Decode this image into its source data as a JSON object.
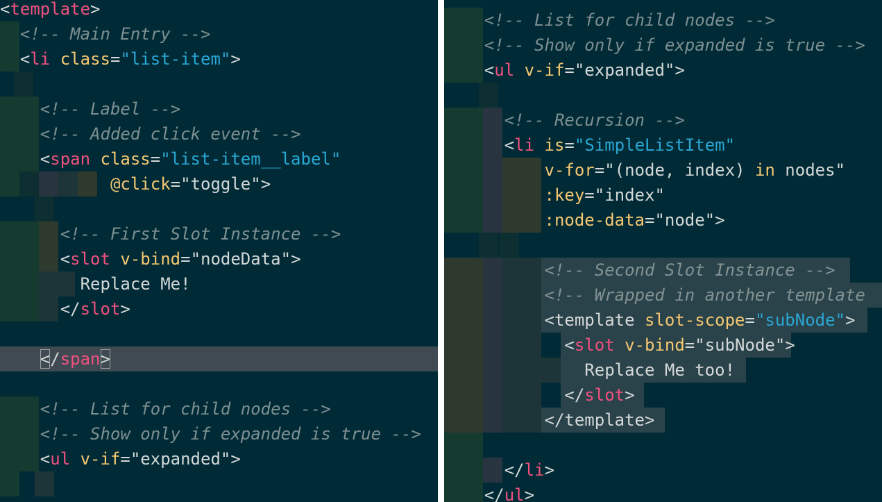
{
  "left_pane": {
    "lines": [
      [
        {
          "t": "<",
          "c": "c-punct"
        },
        {
          "t": "template",
          "c": "c-tag"
        },
        {
          "t": ">",
          "c": "c-punct"
        }
      ],
      [
        {
          "t": "  <!-- Main Entry -->",
          "c": "c-comment"
        }
      ],
      [
        {
          "t": "  <",
          "c": "c-punct"
        },
        {
          "t": "li",
          "c": "c-tag"
        },
        {
          "t": " class",
          "c": "c-attr"
        },
        {
          "t": "=",
          "c": "c-eq"
        },
        {
          "t": "\"list-item\"",
          "c": "c-str"
        },
        {
          "t": ">",
          "c": "c-punct"
        }
      ],
      [],
      [
        {
          "t": "    <!-- Label -->",
          "c": "c-comment"
        }
      ],
      [
        {
          "t": "    <!-- Added click event -->",
          "c": "c-comment"
        }
      ],
      [
        {
          "t": "    <",
          "c": "c-punct"
        },
        {
          "t": "span",
          "c": "c-tag"
        },
        {
          "t": " class",
          "c": "c-attr"
        },
        {
          "t": "=",
          "c": "c-eq"
        },
        {
          "t": "\"list-item__label\"",
          "c": "c-str"
        }
      ],
      [
        {
          "t": "           @click",
          "c": "c-attr"
        },
        {
          "t": "=",
          "c": "c-eq"
        },
        {
          "t": "\"toggle\"",
          "c": "c-text"
        },
        {
          "t": ">",
          "c": "c-punct"
        }
      ],
      [],
      [
        {
          "t": "      <!-- First Slot Instance -->",
          "c": "c-comment"
        }
      ],
      [
        {
          "t": "      <",
          "c": "c-punct"
        },
        {
          "t": "slot",
          "c": "c-tag"
        },
        {
          "t": " v-bind",
          "c": "c-attr"
        },
        {
          "t": "=",
          "c": "c-eq"
        },
        {
          "t": "\"nodeData\"",
          "c": "c-text"
        },
        {
          "t": ">",
          "c": "c-punct"
        }
      ],
      [
        {
          "t": "        Replace Me!",
          "c": "c-text"
        }
      ],
      [
        {
          "t": "      </",
          "c": "c-punct"
        },
        {
          "t": "slot",
          "c": "c-tag"
        },
        {
          "t": ">",
          "c": "c-punct"
        }
      ],
      [],
      [
        {
          "t": "    </",
          "c": "c-punct"
        },
        {
          "t": "span",
          "c": "c-tag"
        },
        {
          "t": ">",
          "c": "c-punct"
        }
      ],
      [],
      [
        {
          "t": "    <!-- List for child nodes -->",
          "c": "c-comment"
        }
      ],
      [
        {
          "t": "    <!-- Show only if expanded is true -->",
          "c": "c-comment"
        }
      ],
      [
        {
          "t": "    <",
          "c": "c-punct"
        },
        {
          "t": "ul",
          "c": "c-tag"
        },
        {
          "t": " v-if",
          "c": "c-attr"
        },
        {
          "t": "=",
          "c": "c-eq"
        },
        {
          "t": "\"expanded\"",
          "c": "c-text"
        },
        {
          "t": ">",
          "c": "c-punct"
        }
      ],
      []
    ]
  },
  "right_pane": {
    "lines": [
      [
        {
          "t": "    <!-- List for child nodes -->",
          "c": "c-comment"
        }
      ],
      [
        {
          "t": "    <!-- Show only if expanded is true -->",
          "c": "c-comment"
        }
      ],
      [
        {
          "t": "    <",
          "c": "c-punct"
        },
        {
          "t": "ul",
          "c": "c-tag"
        },
        {
          "t": " v-if",
          "c": "c-attr"
        },
        {
          "t": "=",
          "c": "c-eq"
        },
        {
          "t": "\"expanded\"",
          "c": "c-text"
        },
        {
          "t": ">",
          "c": "c-punct"
        }
      ],
      [],
      [
        {
          "t": "      <!-- Recursion -->",
          "c": "c-comment"
        }
      ],
      [
        {
          "t": "      <",
          "c": "c-punct"
        },
        {
          "t": "li",
          "c": "c-tag"
        },
        {
          "t": " is",
          "c": "c-attr"
        },
        {
          "t": "=",
          "c": "c-eq"
        },
        {
          "t": "\"SimpleListItem\"",
          "c": "c-str"
        }
      ],
      [
        {
          "t": "          v-for",
          "c": "c-attr"
        },
        {
          "t": "=",
          "c": "c-eq"
        },
        {
          "t": "\"(node, index) ",
          "c": "c-text"
        },
        {
          "t": "in",
          "c": "c-attr"
        },
        {
          "t": " nodes\"",
          "c": "c-text"
        }
      ],
      [
        {
          "t": "          :key",
          "c": "c-attr"
        },
        {
          "t": "=",
          "c": "c-eq"
        },
        {
          "t": "\"index\"",
          "c": "c-text"
        }
      ],
      [
        {
          "t": "          :node-data",
          "c": "c-attr"
        },
        {
          "t": "=",
          "c": "c-eq"
        },
        {
          "t": "\"node\"",
          "c": "c-text"
        },
        {
          "t": ">",
          "c": "c-punct"
        }
      ],
      [],
      [
        {
          "t": "          <!-- Second Slot Instance -->",
          "c": "c-comment"
        }
      ],
      [
        {
          "t": "          <!-- Wrapped in another template",
          "c": "c-comment"
        }
      ],
      [
        {
          "t": "          <",
          "c": "c-punct"
        },
        {
          "t": "template",
          "c": "c-text"
        },
        {
          "t": " slot-scope",
          "c": "c-attr"
        },
        {
          "t": "=",
          "c": "c-eq"
        },
        {
          "t": "\"subNode\"",
          "c": "c-str"
        },
        {
          "t": ">",
          "c": "c-punct"
        }
      ],
      [
        {
          "t": "            <",
          "c": "c-punct"
        },
        {
          "t": "slot",
          "c": "c-tag"
        },
        {
          "t": " v-bind",
          "c": "c-attr"
        },
        {
          "t": "=",
          "c": "c-eq"
        },
        {
          "t": "\"subNode\"",
          "c": "c-text"
        },
        {
          "t": ">",
          "c": "c-punct"
        }
      ],
      [
        {
          "t": "              Replace Me too!",
          "c": "c-text"
        }
      ],
      [
        {
          "t": "            </",
          "c": "c-punct"
        },
        {
          "t": "slot",
          "c": "c-tag"
        },
        {
          "t": ">",
          "c": "c-punct"
        }
      ],
      [
        {
          "t": "          </",
          "c": "c-punct"
        },
        {
          "t": "template",
          "c": "c-text"
        },
        {
          "t": ">",
          "c": "c-punct"
        }
      ],
      [],
      [
        {
          "t": "      </",
          "c": "c-punct"
        },
        {
          "t": "li",
          "c": "c-tag"
        },
        {
          "t": ">",
          "c": "c-punct"
        }
      ],
      [
        {
          "t": "    </",
          "c": "c-punct"
        },
        {
          "t": "ul",
          "c": "c-tag"
        },
        {
          "t": ">",
          "c": "c-punct"
        }
      ]
    ]
  },
  "colors": {
    "background": "#002b36",
    "comment": "#93a1a1",
    "tag": "#f0517f",
    "attribute": "#f5c872",
    "string": "#2aa7d4",
    "text": "#d4d8d8",
    "current_line": "#3f4a52"
  }
}
